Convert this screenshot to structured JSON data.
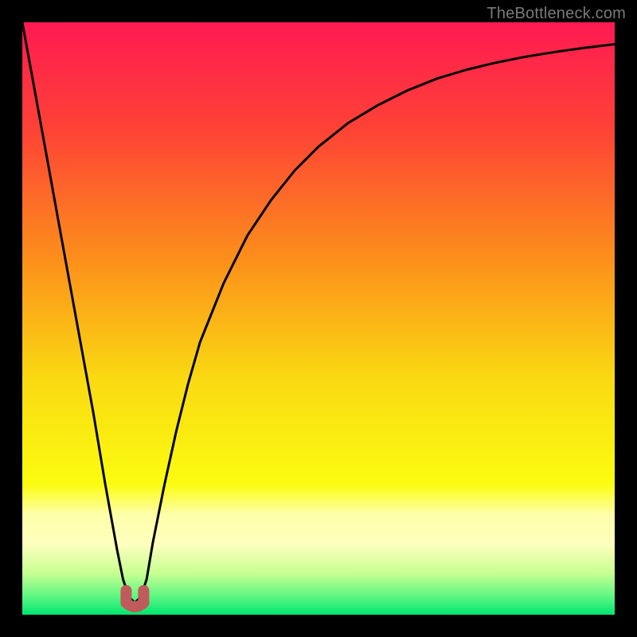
{
  "watermark": "TheBottleneck.com",
  "colors": {
    "frame": "#000000",
    "watermark": "#7a7a7a",
    "curve": "#000000",
    "valley_marker": "#bf5b5b",
    "gradient_stops": [
      {
        "offset": 0.0,
        "color": "#ff1a52"
      },
      {
        "offset": 0.18,
        "color": "#fe4236"
      },
      {
        "offset": 0.4,
        "color": "#fc8f1b"
      },
      {
        "offset": 0.6,
        "color": "#fad912"
      },
      {
        "offset": 0.78,
        "color": "#fbfc10"
      },
      {
        "offset": 0.83,
        "color": "#feffa8"
      },
      {
        "offset": 0.88,
        "color": "#feffbe"
      },
      {
        "offset": 0.93,
        "color": "#c7ff92"
      },
      {
        "offset": 0.97,
        "color": "#5cf683"
      },
      {
        "offset": 1.0,
        "color": "#00e670"
      }
    ]
  },
  "chart_data": {
    "type": "line",
    "title": "",
    "xlabel": "",
    "ylabel": "",
    "xlim": [
      0,
      100
    ],
    "ylim": [
      0,
      100
    ],
    "x": [
      0,
      2,
      4,
      6,
      8,
      10,
      12,
      14,
      16,
      17,
      18,
      19,
      20,
      21,
      22,
      24,
      26,
      28,
      30,
      34,
      38,
      42,
      46,
      50,
      55,
      60,
      65,
      70,
      75,
      80,
      85,
      90,
      95,
      100
    ],
    "series": [
      {
        "name": "bottleneck-curve",
        "values": [
          100,
          89,
          78,
          67,
          56,
          45,
          34,
          22,
          11,
          6,
          3,
          2,
          3,
          6,
          12,
          22,
          31,
          39,
          46,
          56,
          64,
          70,
          75,
          79,
          83,
          86,
          88.5,
          90.5,
          92,
          93.2,
          94.2,
          95,
          95.7,
          96.3
        ]
      }
    ],
    "annotations": [
      {
        "name": "optimal-valley",
        "x": 19,
        "y": 2
      }
    ]
  }
}
